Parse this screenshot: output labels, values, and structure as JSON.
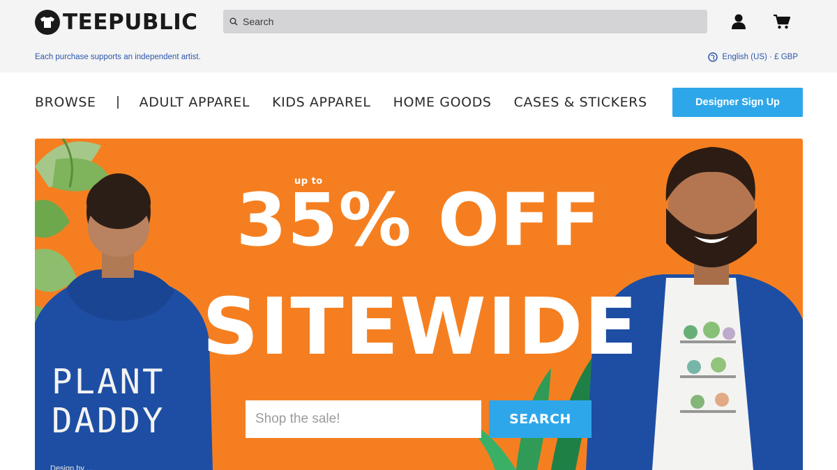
{
  "header": {
    "logo_text": "TEEPUBLIC",
    "search_placeholder": "Search"
  },
  "substrip": {
    "tagline": "Each purchase supports an independent artist.",
    "locale": "English (US) · £ GBP"
  },
  "nav": {
    "browse": "BROWSE",
    "items": [
      "ADULT APPAREL",
      "KIDS APPAREL",
      "HOME GOODS",
      "CASES & STICKERS"
    ],
    "designer_signup": "Designer Sign Up"
  },
  "hero": {
    "kicker": "up to",
    "headline_1": "35% OFF",
    "headline_2": "SITEWIDE",
    "shop_placeholder": "Shop the sale!",
    "search_button": "SEARCH",
    "print_line_1": "PLANT",
    "print_line_2": "DADDY",
    "credit": "Design by ..."
  },
  "colors": {
    "hero_bg": "#f57f20",
    "accent": "#2ea7ea",
    "link": "#2b56a8",
    "header_bg": "#f4f4f5"
  },
  "icons": {
    "logo": "tshirt-logo-icon",
    "search": "search-icon",
    "account": "user-icon",
    "cart": "cart-icon",
    "locale": "globe-icon"
  }
}
